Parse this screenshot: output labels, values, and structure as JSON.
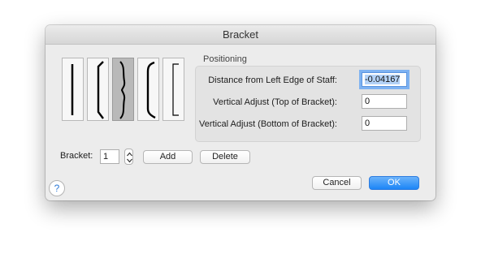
{
  "window": {
    "title": "Bracket"
  },
  "bracket_styles": [
    {
      "name": "plain-bar",
      "selected": false
    },
    {
      "name": "square-bracket",
      "selected": false
    },
    {
      "name": "curly-brace",
      "selected": true
    },
    {
      "name": "curved-bracket",
      "selected": false
    },
    {
      "name": "thin-square-bracket",
      "selected": false
    }
  ],
  "positioning": {
    "title": "Positioning",
    "rows": [
      {
        "label": "Distance from Left Edge of Staff:",
        "value": "-0.04167"
      },
      {
        "label": "Vertical Adjust (Top of Bracket):",
        "value": "0"
      },
      {
        "label": "Vertical Adjust (Bottom of Bracket):",
        "value": "0"
      }
    ]
  },
  "bracket_number": {
    "label": "Bracket:",
    "value": "1"
  },
  "buttons": {
    "add": "Add",
    "delete": "Delete",
    "cancel": "Cancel",
    "ok": "OK"
  },
  "help": {
    "glyph": "?"
  },
  "colors": {
    "primary": "#1c85f7",
    "focus_ring": "#7eb2f1"
  }
}
